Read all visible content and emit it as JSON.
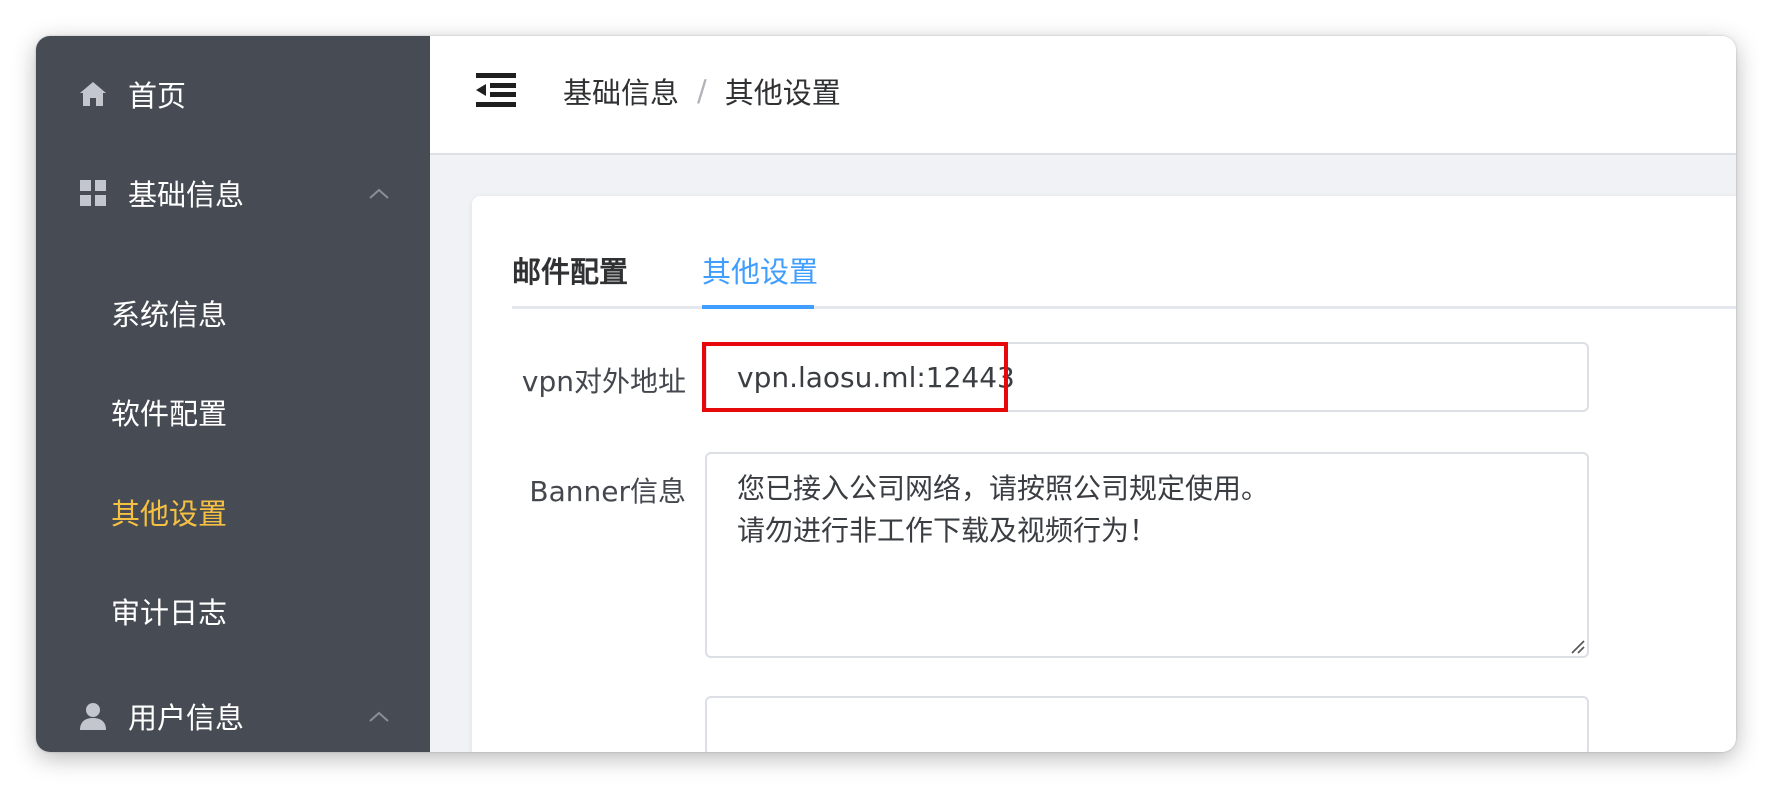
{
  "sidebar": {
    "items": [
      {
        "label": "首页",
        "icon": "home-icon"
      },
      {
        "label": "基础信息",
        "icon": "grid-icon",
        "expanded": true,
        "children": [
          {
            "label": "系统信息"
          },
          {
            "label": "软件配置"
          },
          {
            "label": "其他设置",
            "active": true
          },
          {
            "label": "审计日志"
          }
        ]
      },
      {
        "label": "用户信息",
        "icon": "user-icon",
        "expanded": true
      }
    ]
  },
  "header": {
    "breadcrumb": [
      "基础信息",
      "其他设置"
    ],
    "separator": "/"
  },
  "tabs": [
    {
      "label": "邮件配置",
      "active": false
    },
    {
      "label": "其他设置",
      "active": true
    }
  ],
  "form": {
    "vpn_label": "vpn对外地址",
    "vpn_value": "vpn.laosu.ml:12443",
    "banner_label": "Banner信息",
    "banner_value": "您已接入公司网络，请按照公司规定使用。\n请勿进行非工作下载及视频行为！"
  },
  "colors": {
    "sidebar_bg": "#474c54",
    "active_menu": "#f6c042",
    "accent": "#409eff",
    "highlight": "#e6080b"
  }
}
